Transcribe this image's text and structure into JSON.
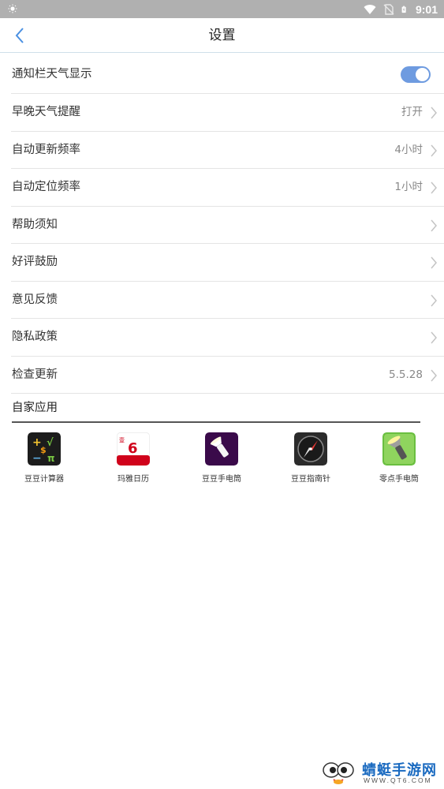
{
  "status_bar": {
    "time": "9:01",
    "icons": [
      "brightness-icon",
      "wifi-icon",
      "no-sim-icon",
      "battery-icon"
    ]
  },
  "header": {
    "title": "设置",
    "back_icon": "chevron-left-icon"
  },
  "settings": {
    "items": [
      {
        "label": "通知栏天气显示",
        "value": "",
        "control": "toggle",
        "toggle_on": true
      },
      {
        "label": "早晚天气提醒",
        "value": "打开",
        "control": "chevron"
      },
      {
        "label": "自动更新频率",
        "value": "4小时",
        "control": "chevron"
      },
      {
        "label": "自动定位频率",
        "value": "1小时",
        "control": "chevron"
      },
      {
        "label": "帮助须知",
        "value": "",
        "control": "chevron"
      },
      {
        "label": "好评鼓励",
        "value": "",
        "control": "chevron"
      },
      {
        "label": "意见反馈",
        "value": "",
        "control": "chevron"
      },
      {
        "label": "隐私政策",
        "value": "",
        "control": "chevron"
      },
      {
        "label": "检查更新",
        "value": "5.5.28",
        "control": "chevron"
      }
    ]
  },
  "own_apps": {
    "title": "自家应用",
    "apps": [
      {
        "label": "豆豆计算器",
        "icon": "calculator-icon"
      },
      {
        "label": "玛雅日历",
        "icon": "calendar-icon"
      },
      {
        "label": "豆豆手电筒",
        "icon": "flashlight-icon"
      },
      {
        "label": "豆豆指南针",
        "icon": "compass-icon"
      },
      {
        "label": "零点手电筒",
        "icon": "flashlight-green-icon"
      }
    ]
  },
  "watermark": {
    "text": "蜻蜓手游网",
    "url": "WWW.QT6.COM"
  },
  "colors": {
    "status_bar_bg": "#b0b0b0",
    "accent": "#6e9be0",
    "back_icon": "#4a90e2",
    "divider": "#e4e4e4"
  }
}
